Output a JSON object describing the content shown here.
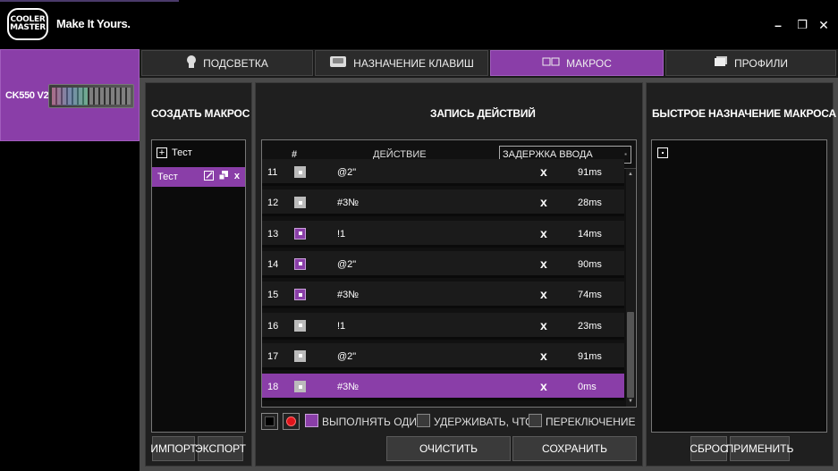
{
  "header": {
    "logo_line1": "COOLER",
    "logo_line2": "MASTER",
    "tagline": "Make It Yours."
  },
  "window": {
    "minimize": "–",
    "maximize": "❐",
    "close": "✕"
  },
  "device": {
    "name": "CK550 V2"
  },
  "tabs": [
    {
      "label": "ПОДСВЕТКА",
      "icon": "lightbulb-icon"
    },
    {
      "label": "НАЗНАЧЕНИЕ КЛАВИШ",
      "icon": "keycap-icon"
    },
    {
      "label": "МАКРОС",
      "icon": "macro-icon",
      "active": true
    },
    {
      "label": "ПРОФИЛИ",
      "icon": "profiles-icon"
    }
  ],
  "create_macro": {
    "title": "СОЗДАТЬ МАКРОС",
    "add_item": "Тест",
    "selected_item": "Тест",
    "import_label": "ИМПОРТ",
    "export_label": "ЭКСПОРТ"
  },
  "recording": {
    "title": "ЗАПИСЬ ДЕЙСТВИЙ",
    "col_num": "#",
    "col_action": "ДЕЙСТВИЕ",
    "delay_select": "ЗАДЕРЖКА ВВОДА",
    "rows": [
      {
        "num": "11",
        "state": "up",
        "action": "@2\"",
        "del": "x",
        "delay": "91ms"
      },
      {
        "num": "12",
        "state": "up",
        "action": "#3№",
        "del": "x",
        "delay": "28ms"
      },
      {
        "num": "13",
        "state": "down",
        "action": "!1",
        "del": "x",
        "delay": "14ms"
      },
      {
        "num": "14",
        "state": "down",
        "action": "@2\"",
        "del": "x",
        "delay": "90ms"
      },
      {
        "num": "15",
        "state": "down",
        "action": "#3№",
        "del": "x",
        "delay": "74ms"
      },
      {
        "num": "16",
        "state": "up",
        "action": "!1",
        "del": "x",
        "delay": "23ms"
      },
      {
        "num": "17",
        "state": "up",
        "action": "@2\"",
        "del": "x",
        "delay": "91ms"
      },
      {
        "num": "18",
        "state": "up",
        "action": "#3№",
        "del": "x",
        "delay": "0ms",
        "selected": true
      }
    ],
    "opt_run_once": "ВЫПОЛНЯТЬ ОДИН",
    "opt_hold": "УДЕРЖИВАТЬ, ЧТОБ",
    "opt_toggle": "ПЕРЕКЛЮЧЕНИЕ ЦИ",
    "clear_label": "ОЧИСТИТЬ",
    "save_label": "СОХРАНИТЬ"
  },
  "quick_assign": {
    "title": "БЫСТРОЕ НАЗНАЧЕНИЕ МАКРОСА",
    "reset_label": "СБРОС",
    "apply_label": "ПРИМЕНИТЬ"
  },
  "colors": {
    "accent": "#8a3ea8",
    "panel": "#1f1f1f",
    "background": "#000000"
  }
}
